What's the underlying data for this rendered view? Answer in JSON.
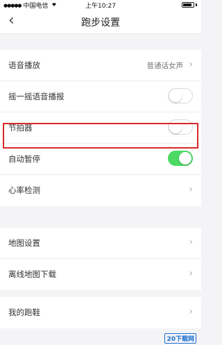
{
  "status": {
    "carrier": "中国电信",
    "time": "上午10:27"
  },
  "nav": {
    "back": "‹",
    "title": "跑步设置"
  },
  "group1": [
    {
      "label": "语音播放",
      "value": "普通话女声",
      "type": "chevron"
    },
    {
      "label": "摇一摇语音播报",
      "type": "toggle",
      "on": false
    },
    {
      "label": "节拍器",
      "type": "toggle",
      "on": false
    },
    {
      "label": "自动暂停",
      "type": "toggle",
      "on": true
    },
    {
      "label": "心率检测",
      "type": "chevron"
    }
  ],
  "group2": [
    {
      "label": "地图设置",
      "type": "chevron"
    },
    {
      "label": "离线地图下载",
      "type": "chevron"
    }
  ],
  "group3": [
    {
      "label": "我的跑鞋",
      "type": "chevron"
    }
  ],
  "chevron": "›",
  "watermark": {
    "logo": "20下载网",
    "sub": ""
  },
  "colors": {
    "toggle_on": "#4cd964",
    "highlight": "#d62828"
  }
}
